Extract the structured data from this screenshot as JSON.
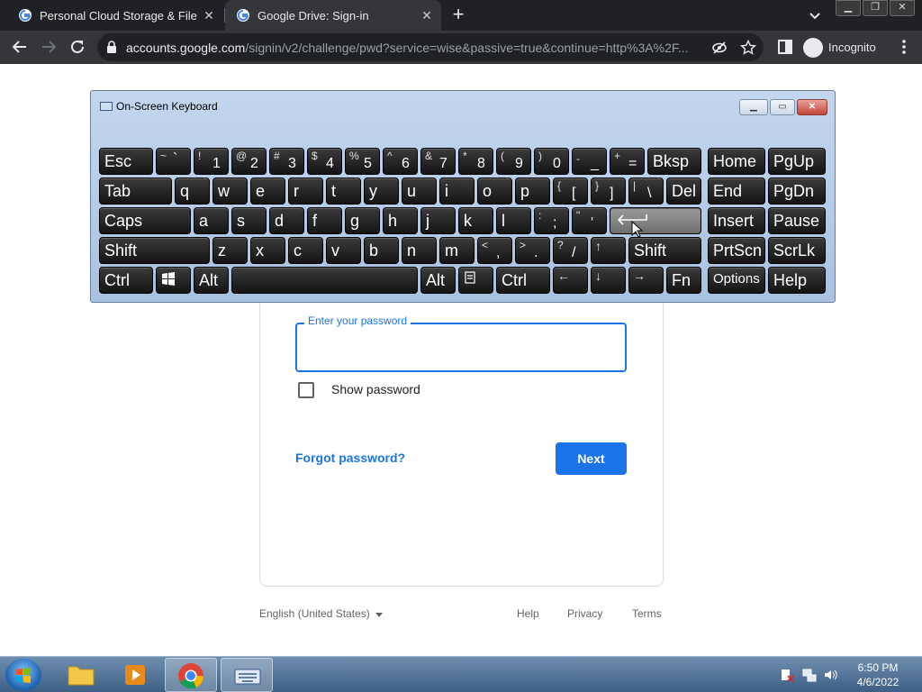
{
  "browser": {
    "tabs": [
      {
        "title": "Personal Cloud Storage & File Sh",
        "active": false
      },
      {
        "title": "Google Drive: Sign-in",
        "active": true
      }
    ],
    "url_host": "accounts.google.com",
    "url_path": "/signin/v2/challenge/pwd?service=wise&passive=true&continue=http%3A%2F...",
    "profile_label": "Incognito"
  },
  "signin": {
    "password_label": "Enter your password",
    "password_value": "",
    "show_password_label": "Show password",
    "forgot_label": "Forgot password?",
    "next_label": "Next",
    "language": "English (United States)",
    "footer_links": [
      "Help",
      "Privacy",
      "Terms"
    ],
    "accent_color": "#1a73e8"
  },
  "osk": {
    "title": "On-Screen Keyboard",
    "keys": {
      "esc": "Esc",
      "bksp": "Bksp",
      "home": "Home",
      "pgup": "PgUp",
      "tab": "Tab",
      "del": "Del",
      "end": "End",
      "pgdn": "PgDn",
      "caps": "Caps",
      "insert": "Insert",
      "pause": "Pause",
      "shift_l": "Shift",
      "shift_r": "Shift",
      "prtscn": "PrtScn",
      "scrlk": "ScrLk",
      "ctrl_l": "Ctrl",
      "alt_l": "Alt",
      "alt_r": "Alt",
      "ctrl_r": "Ctrl",
      "fn": "Fn",
      "options": "Options",
      "help": "Help",
      "row1": [
        {
          "top": "~",
          "bot": "`"
        },
        {
          "top": "!",
          "bot": "1"
        },
        {
          "top": "@",
          "bot": "2"
        },
        {
          "top": "#",
          "bot": "3"
        },
        {
          "top": "$",
          "bot": "4"
        },
        {
          "top": "%",
          "bot": "5"
        },
        {
          "top": "^",
          "bot": "6"
        },
        {
          "top": "&",
          "bot": "7"
        },
        {
          "top": "*",
          "bot": "8"
        },
        {
          "top": "(",
          "bot": "9"
        },
        {
          "top": ")",
          "bot": "0"
        },
        {
          "top": "-",
          "bot": "_"
        },
        {
          "top": "+",
          "bot": "="
        }
      ],
      "row2": [
        "q",
        "w",
        "e",
        "r",
        "t",
        "y",
        "u",
        "i",
        "o",
        "p"
      ],
      "row2_sym": [
        {
          "top": "{",
          "bot": "["
        },
        {
          "top": "}",
          "bot": "]"
        },
        {
          "top": "|",
          "bot": "\\"
        }
      ],
      "row3": [
        "a",
        "s",
        "d",
        "f",
        "g",
        "h",
        "j",
        "k",
        "l"
      ],
      "row3_sym": [
        {
          "top": ":",
          "bot": ";"
        },
        {
          "top": "\"",
          "bot": "'"
        }
      ],
      "row4": [
        "z",
        "x",
        "c",
        "v",
        "b",
        "n",
        "m"
      ],
      "row4_sym": [
        {
          "top": "<",
          "bot": ","
        },
        {
          "top": ">",
          "bot": "."
        },
        {
          "top": "?",
          "bot": "/"
        }
      ],
      "arrows": {
        "left": "←",
        "down": "↓",
        "right": "→",
        "up": "↑"
      }
    }
  },
  "taskbar": {
    "time": "6:50 PM",
    "date": "4/6/2022"
  }
}
